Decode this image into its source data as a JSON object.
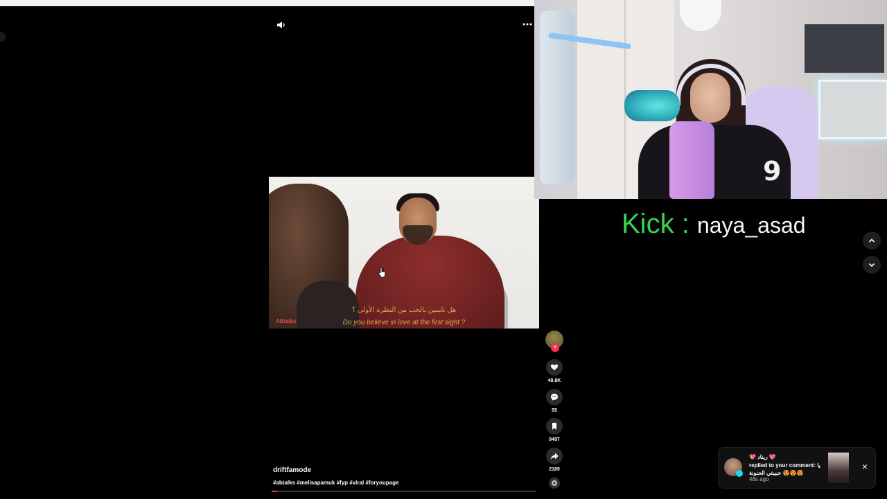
{
  "player": {
    "sound_icon": "speaker-icon",
    "more_icon": "ellipsis-icon",
    "video": {
      "subtitle_ar": "هل تامنين بالحب من النظرة الأولى ؟",
      "subtitle_en": "Do you believe in love at the first sight ?",
      "watermark": "ABtalks"
    },
    "author": "driftfamode",
    "hashtags": "#abtalks #melisapamuk #fyp #viral #foryoupage",
    "progress_fraction": 0.02
  },
  "rail": {
    "follow_label": "+",
    "likes": "48.8K",
    "comments": "55",
    "saves": "8497",
    "shares": "2189"
  },
  "kick": {
    "word": "Kick",
    "colon": ":",
    "username": "naya_asad"
  },
  "toast": {
    "name": "💖 ريناد 💖",
    "message": "replied to your comment: يا حبيبتي الحنونة 😍😍😍",
    "time": "48s ago",
    "close": "×"
  },
  "colors": {
    "accent": "#fe2c55",
    "kick_green": "#39d353",
    "subtitle": "#e3a24f"
  }
}
